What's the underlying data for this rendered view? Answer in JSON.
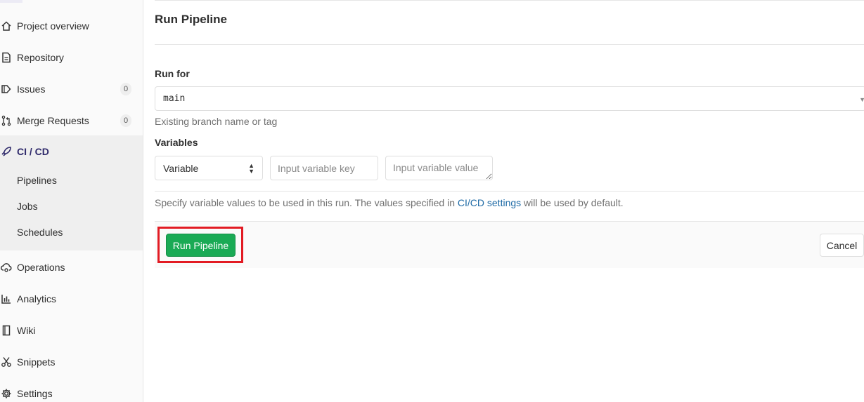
{
  "sidebar": {
    "items": [
      {
        "label": "Project overview",
        "icon": "home-icon"
      },
      {
        "label": "Repository",
        "icon": "document-icon"
      },
      {
        "label": "Issues",
        "icon": "issues-icon",
        "count": "0"
      },
      {
        "label": "Merge Requests",
        "icon": "merge-request-icon",
        "count": "0"
      },
      {
        "label": "CI / CD",
        "icon": "rocket-icon",
        "active": true
      },
      {
        "label": "Operations",
        "icon": "cloud-gear-icon"
      },
      {
        "label": "Analytics",
        "icon": "chart-icon"
      },
      {
        "label": "Wiki",
        "icon": "book-icon"
      },
      {
        "label": "Snippets",
        "icon": "scissors-icon"
      },
      {
        "label": "Settings",
        "icon": "gear-icon"
      }
    ],
    "cicd_subitems": [
      "Pipelines",
      "Jobs",
      "Schedules"
    ]
  },
  "main": {
    "title": "Run Pipeline",
    "run_for": {
      "label": "Run for",
      "value": "main",
      "help": "Existing branch name or tag"
    },
    "variables": {
      "label": "Variables",
      "type_value": "Variable",
      "key_placeholder": "Input variable key",
      "value_placeholder": "Input variable value",
      "help_prefix": "Specify variable values to be used in this run. The values specified in ",
      "help_link": "CI/CD settings",
      "help_suffix": " will be used by default."
    },
    "actions": {
      "run_label": "Run Pipeline",
      "cancel_label": "Cancel"
    }
  },
  "colors": {
    "primary_button": "#1aaa55",
    "highlight_box": "#e21b23",
    "link": "#1f6ba6"
  }
}
